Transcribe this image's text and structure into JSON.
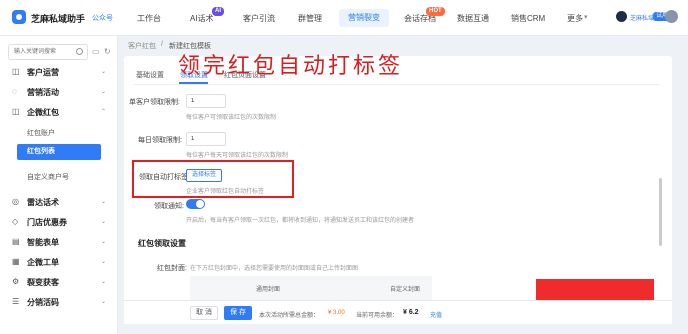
{
  "header": {
    "brand": "芝麻私域助手",
    "brand_tag": "公众号",
    "nav": [
      "工作台",
      "AI话术",
      "客户引流",
      "群管理",
      "营销裂变",
      "会话存档",
      "数据互通",
      "销售CRM",
      "更多"
    ],
    "badge_ai": "AI",
    "badge_hot": "HOT",
    "user_name": "芝麻私域",
    "user_tag": "试用"
  },
  "sidebar": {
    "search_placeholder": "输入关键词搜索",
    "items": [
      {
        "label": "客户运营",
        "icon": "customer-icon"
      },
      {
        "label": "营销活动",
        "icon": "activity-icon"
      },
      {
        "label": "企微红包",
        "icon": "redpacket-icon"
      },
      {
        "label": "雷达话术",
        "icon": "radar-icon"
      },
      {
        "label": "门店优惠券",
        "icon": "coupon-icon"
      },
      {
        "label": "智能表单",
        "icon": "form-icon"
      },
      {
        "label": "企微工单",
        "icon": "ticket-icon"
      },
      {
        "label": "裂变获客",
        "icon": "fission-icon"
      },
      {
        "label": "分销活码",
        "icon": "distribution-icon"
      }
    ],
    "subitems": [
      "红包账户",
      "红包列表",
      "自定义商户号"
    ]
  },
  "breadcrumb": [
    "客户红包",
    "/",
    "新建红包模板"
  ],
  "tabs": [
    "基础设置",
    "领取设置",
    "红包页面设置"
  ],
  "form": {
    "single_limit_label": "单客户领取限制:",
    "single_limit_value": "1",
    "single_limit_hint": "每位客户可领取该红包的次数限制",
    "daily_limit_label": "每日领取限制:",
    "daily_limit_value": "1",
    "daily_limit_hint": "每位客户每天可领取该红包的次数限制",
    "auto_tag_label": "领取自动打标签:",
    "select_tag_button": "选择标签",
    "auto_tag_hint": "企业客户领取红包自动打标签",
    "notify_label": "领取通知:",
    "notify_on": true,
    "notify_hint": "开启后，每当有客户领取一次红包，都将收到通知，将通知发送员工和该红包的创建者",
    "section_title": "红包领取设置",
    "cover_label": "红包封面:",
    "cover_hint": "在下方红包封面中，选择您需要使用的封面图或自己上传封面图",
    "cover_col_1": "通用封面",
    "cover_col_2": "自定义封面"
  },
  "annotation": "领完红包自动打标签",
  "footer": {
    "cancel": "取 消",
    "save": "保 存",
    "total_label": "本次活动所需总金额：",
    "total_value": "¥ 3.00",
    "balance_label": "当前可用余额：",
    "balance_value": "¥ 6.2",
    "recharge": "充值"
  },
  "colors": {
    "accent": "#2f7cf6",
    "annotation": "#d81e1e",
    "warning": "#f26b1d"
  }
}
